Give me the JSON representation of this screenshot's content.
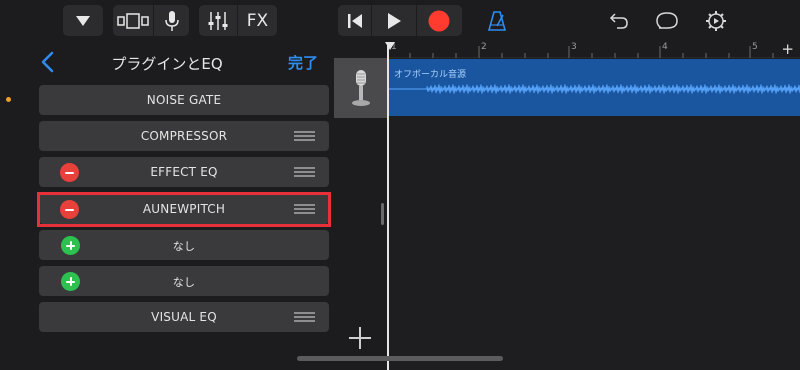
{
  "toolbar": {
    "fx_label": "FX",
    "icons": [
      "dropdown-triangle-icon",
      "view-toggle-icon",
      "microphone-icon",
      "mixer-sliders-icon",
      "fx-button",
      "rewind-icon",
      "play-icon",
      "record-icon",
      "metronome-icon",
      "undo-icon",
      "loop-icon",
      "settings-icon"
    ],
    "record_color": "#ff3b30",
    "metronome_color": "#2f8cf0"
  },
  "plugin_panel": {
    "title": "プラグインとEQ",
    "done_label": "完了",
    "slots": [
      {
        "label": "NOISE GATE",
        "control": "none",
        "handle": false
      },
      {
        "label": "COMPRESSOR",
        "control": "none",
        "handle": true
      },
      {
        "label": "EFFECT EQ",
        "control": "remove",
        "handle": true
      },
      {
        "label": "AUNEWPITCH",
        "control": "remove",
        "handle": true,
        "selected": true
      },
      {
        "label": "なし",
        "control": "add",
        "handle": false
      },
      {
        "label": "なし",
        "control": "add",
        "handle": false
      },
      {
        "label": "VISUAL EQ",
        "control": "none",
        "handle": true
      }
    ]
  },
  "timeline": {
    "ruler_marks": [
      "1",
      "2",
      "3",
      "4",
      "5"
    ],
    "ruler_plus": "+",
    "region_name": "オフボーカル音源",
    "region_color": "#1a55a0",
    "waveform_color": "#5aa8ff"
  }
}
